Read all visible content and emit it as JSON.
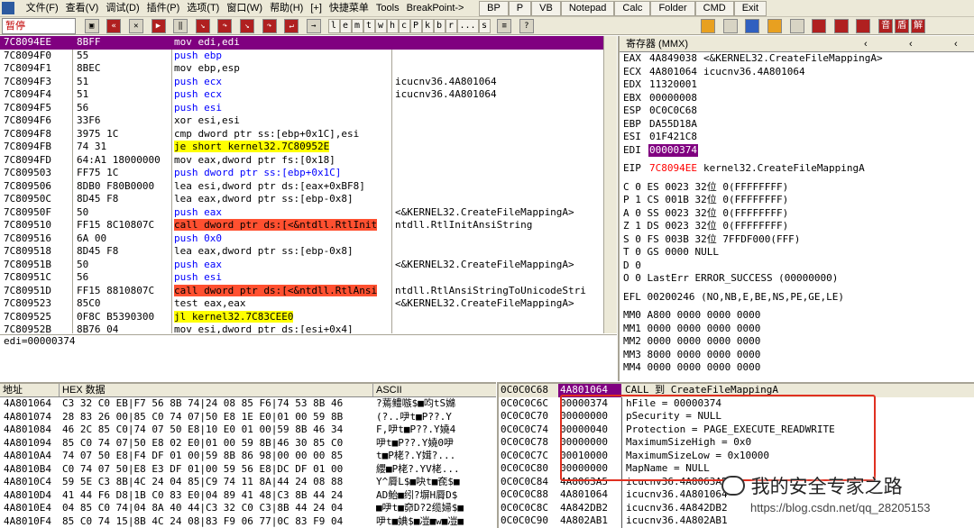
{
  "menubar": {
    "items": [
      "文件(F)",
      "查看(V)",
      "调试(D)",
      "插件(P)",
      "选项(T)",
      "窗口(W)",
      "帮助(H)",
      "[+]",
      "快捷菜单",
      "Tools",
      "BreakPoint->"
    ],
    "external": [
      "BP",
      "P",
      "VB",
      "Notepad",
      "Calc",
      "Folder",
      "CMD",
      "Exit"
    ]
  },
  "toolbar": {
    "status": "暂停",
    "letters": [
      "l",
      "e",
      "m",
      "t",
      "w",
      "h",
      "c",
      "P",
      "k",
      "b",
      "r",
      "...",
      "s"
    ],
    "right_icons": [
      "音",
      "盾",
      "解"
    ]
  },
  "disasm": {
    "rows": [
      {
        "addr": "7C8094EE",
        "hex": "8BFF",
        "ins": "mov edi,edi",
        "cmt": "",
        "style": "sel"
      },
      {
        "addr": "7C8094F0",
        "hex": "55",
        "ins": "push ebp",
        "cmt": "",
        "style": "blue"
      },
      {
        "addr": "7C8094F1",
        "hex": "8BEC",
        "ins": "mov ebp,esp",
        "cmt": "",
        "style": ""
      },
      {
        "addr": "7C8094F3",
        "hex": "51",
        "ins": "push ecx",
        "cmt": "icucnv36.4A801064",
        "style": "blue"
      },
      {
        "addr": "7C8094F4",
        "hex": "51",
        "ins": "push ecx",
        "cmt": "icucnv36.4A801064",
        "style": "blue"
      },
      {
        "addr": "7C8094F5",
        "hex": "56",
        "ins": "push esi",
        "cmt": "",
        "style": "blue"
      },
      {
        "addr": "7C8094F6",
        "hex": "33F6",
        "ins": "xor esi,esi",
        "cmt": "",
        "style": ""
      },
      {
        "addr": "7C8094F8",
        "hex": "3975 1C",
        "ins": "cmp dword ptr ss:[ebp+0x1C],esi",
        "cmt": "",
        "style": ""
      },
      {
        "addr": "7C8094FB",
        "hex": "74 31",
        "ins": "je short kernel32.7C80952E",
        "cmt": "",
        "style": "jmp"
      },
      {
        "addr": "7C8094FD",
        "hex": "64:A1 18000000",
        "ins": "mov eax,dword ptr fs:[0x18]",
        "cmt": "",
        "style": ""
      },
      {
        "addr": "7C809503",
        "hex": "FF75 1C",
        "ins": "push dword ptr ss:[ebp+0x1C]",
        "cmt": "",
        "style": "blue"
      },
      {
        "addr": "7C809506",
        "hex": "8DB0 F80B0000",
        "ins": "lea esi,dword ptr ds:[eax+0xBF8]",
        "cmt": "",
        "style": ""
      },
      {
        "addr": "7C80950C",
        "hex": "8D45 F8",
        "ins": "lea eax,dword ptr ss:[ebp-0x8]",
        "cmt": "",
        "style": ""
      },
      {
        "addr": "7C80950F",
        "hex": "50",
        "ins": "push eax",
        "cmt": "<&KERNEL32.CreateFileMappingA>",
        "style": "blue"
      },
      {
        "addr": "7C809510",
        "hex": "FF15 8C10807C",
        "ins": "call dword ptr ds:[<&ntdll.RtlInit",
        "cmt": "ntdll.RtlInitAnsiString",
        "style": "call"
      },
      {
        "addr": "7C809516",
        "hex": "6A 00",
        "ins": "push 0x0",
        "cmt": "",
        "style": "blue"
      },
      {
        "addr": "7C809518",
        "hex": "8D45 F8",
        "ins": "lea eax,dword ptr ss:[ebp-0x8]",
        "cmt": "",
        "style": ""
      },
      {
        "addr": "7C80951B",
        "hex": "50",
        "ins": "push eax",
        "cmt": "<&KERNEL32.CreateFileMappingA>",
        "style": "blue"
      },
      {
        "addr": "7C80951C",
        "hex": "56",
        "ins": "push esi",
        "cmt": "",
        "style": "blue"
      },
      {
        "addr": "7C80951D",
        "hex": "FF15 8810807C",
        "ins": "call dword ptr ds:[<&ntdll.RtlAnsi",
        "cmt": "ntdll.RtlAnsiStringToUnicodeStri",
        "style": "call"
      },
      {
        "addr": "7C809523",
        "hex": "85C0",
        "ins": "test eax,eax",
        "cmt": "<&KERNEL32.CreateFileMappingA>",
        "style": ""
      },
      {
        "addr": "7C809525",
        "hex": "0F8C B5390300",
        "ins": "jl kernel32.7C83CEE0",
        "cmt": "",
        "style": "jmp"
      },
      {
        "addr": "7C80952B",
        "hex": "8B76 04",
        "ins": "mov esi,dword ptr ds:[esi+0x4]",
        "cmt": "",
        "style": ""
      }
    ],
    "info": "edi=00000374"
  },
  "registers": {
    "title": "寄存器 (MMX)",
    "gp": [
      {
        "n": "EAX",
        "v": "4A849038",
        "c": "<&KERNEL32.CreateFileMappingA>"
      },
      {
        "n": "ECX",
        "v": "4A801064",
        "c": "icucnv36.4A801064"
      },
      {
        "n": "EDX",
        "v": "11320001",
        "c": ""
      },
      {
        "n": "EBX",
        "v": "00000008",
        "c": ""
      },
      {
        "n": "ESP",
        "v": "0C0C0C68",
        "c": ""
      },
      {
        "n": "EBP",
        "v": "DA55D18A",
        "c": ""
      },
      {
        "n": "ESI",
        "v": "01F421C8",
        "c": ""
      },
      {
        "n": "EDI",
        "v": "00000374",
        "c": ""
      }
    ],
    "eip": {
      "n": "EIP",
      "v": "7C8094EE",
      "c": "kernel32.CreateFileMappingA"
    },
    "flags": [
      "C 0  ES 0023 32位 0(FFFFFFFF)",
      "P 1  CS 001B 32位 0(FFFFFFFF)",
      "A 0  SS 0023 32位 0(FFFFFFFF)",
      "Z 1  DS 0023 32位 0(FFFFFFFF)",
      "S 0  FS 003B 32位 7FFDF000(FFF)",
      "T 0  GS 0000 NULL",
      "D 0",
      "O 0  LastErr ERROR_SUCCESS (00000000)"
    ],
    "efl": "EFL 00200246 (NO,NB,E,BE,NS,PE,GE,LE)",
    "mm": [
      "MM0 A800 0000 0000 0000",
      "MM1 0000 0000 0000 0000",
      "MM2 0000 0000 0000 0000",
      "MM3 8000 0000 0000 0000",
      "MM4 0000 0000 0000 0000"
    ]
  },
  "dump": {
    "headers": [
      "地址",
      "HEX 数据",
      "ASCII"
    ],
    "rows": [
      {
        "a": "4A801064",
        "h": "C3 32 C0 EB|F7 56 8B 74|24 08 85 F6|74 53 8B 46",
        "s": "?蔫鳢嗾$■呁tS嬵"
      },
      {
        "a": "4A801074",
        "h": "28 83 26 00|85 C0 74 07|50 E8 1E E0|01 00 59 8B",
        "s": "(?..吚t■P??.Y"
      },
      {
        "a": "4A801084",
        "h": "46 2C 85 C0|74 07 50 E8|10 E0 01 00|59 8B 46 34",
        "s": "F,吚t■P??.Y嬈4"
      },
      {
        "a": "4A801094",
        "h": "85 C0 74 07|50 E8 02 E0|01 00 59 8B|46 30 85 C0",
        "s": "吚t■P??.Y嬈0吚"
      },
      {
        "a": "4A8010A4",
        "h": "74 07 50 E8|F4 DF 01 00|59 8B 86 98|00 00 00 85",
        "s": "t■P栳?.Y媶?..."
      },
      {
        "a": "4A8010B4",
        "h": "C0 74 07 50|E8 E3 DF 01|00 59 56 E8|DC DF 01 00",
        "s": "纓■P栳?.YV栳..."
      },
      {
        "a": "4A8010C4",
        "h": "59 5E C3 8B|4C 24 04 85|C9 74 11 8A|44 24 08 88",
        "s": "Y^脣L$■吷t■奃$■"
      },
      {
        "a": "4A8010D4",
        "h": "41 44 F6 D8|1B C0 83 E0|04 89 41 48|C3 8B 44 24",
        "s": "AD鲐■纼?塀H脣D$"
      },
      {
        "a": "4A8010E4",
        "h": "04 85 C0 74|04 8A 40 44|C3 32 C0 C3|8B 44 24 04",
        "s": "■吚t■奅D?2缆婦$■"
      },
      {
        "a": "4A8010F4",
        "h": "85 C0 74 15|8B 4C 24 08|83 F9 06 77|0C 83 F9 04",
        "s": "吚t■婰$■凒■w■凒■"
      }
    ]
  },
  "stack": {
    "head_addr": "0C0C0C68",
    "head_val": "4A801064",
    "head_cmt": "CALL 到 CreateFileMappingA",
    "rows": [
      {
        "a": "0C0C0C6C",
        "v": "00000374",
        "c": "hFile = 00000374"
      },
      {
        "a": "0C0C0C70",
        "v": "00000000",
        "c": "pSecurity = NULL"
      },
      {
        "a": "0C0C0C74",
        "v": "00000040",
        "c": "Protection = PAGE_EXECUTE_READWRITE"
      },
      {
        "a": "0C0C0C78",
        "v": "00000000",
        "c": "MaximumSizeHigh = 0x0"
      },
      {
        "a": "0C0C0C7C",
        "v": "00010000",
        "c": "MaximumSizeLow = 0x10000"
      },
      {
        "a": "0C0C0C80",
        "v": "00000000",
        "c": "MapName = NULL"
      },
      {
        "a": "0C0C0C84",
        "v": "4A8063A5",
        "c": "icucnv36.4A8063A5"
      },
      {
        "a": "0C0C0C88",
        "v": "4A801064",
        "c": "icucnv36.4A801064"
      },
      {
        "a": "0C0C0C8C",
        "v": "4A842DB2",
        "c": "icucnv36.4A842DB2"
      },
      {
        "a": "0C0C0C90",
        "v": "4A802AB1",
        "c": "icucnv36.4A802AB1"
      }
    ]
  },
  "watermark": {
    "title": "我的安全专家之路",
    "url": "https://blog.csdn.net/qq_28205153"
  },
  "colors": {
    "accent": "#800080",
    "call": "#ff5030",
    "jump": "#ffff00",
    "keyword": "#0000ff",
    "annot": "#e03020"
  }
}
